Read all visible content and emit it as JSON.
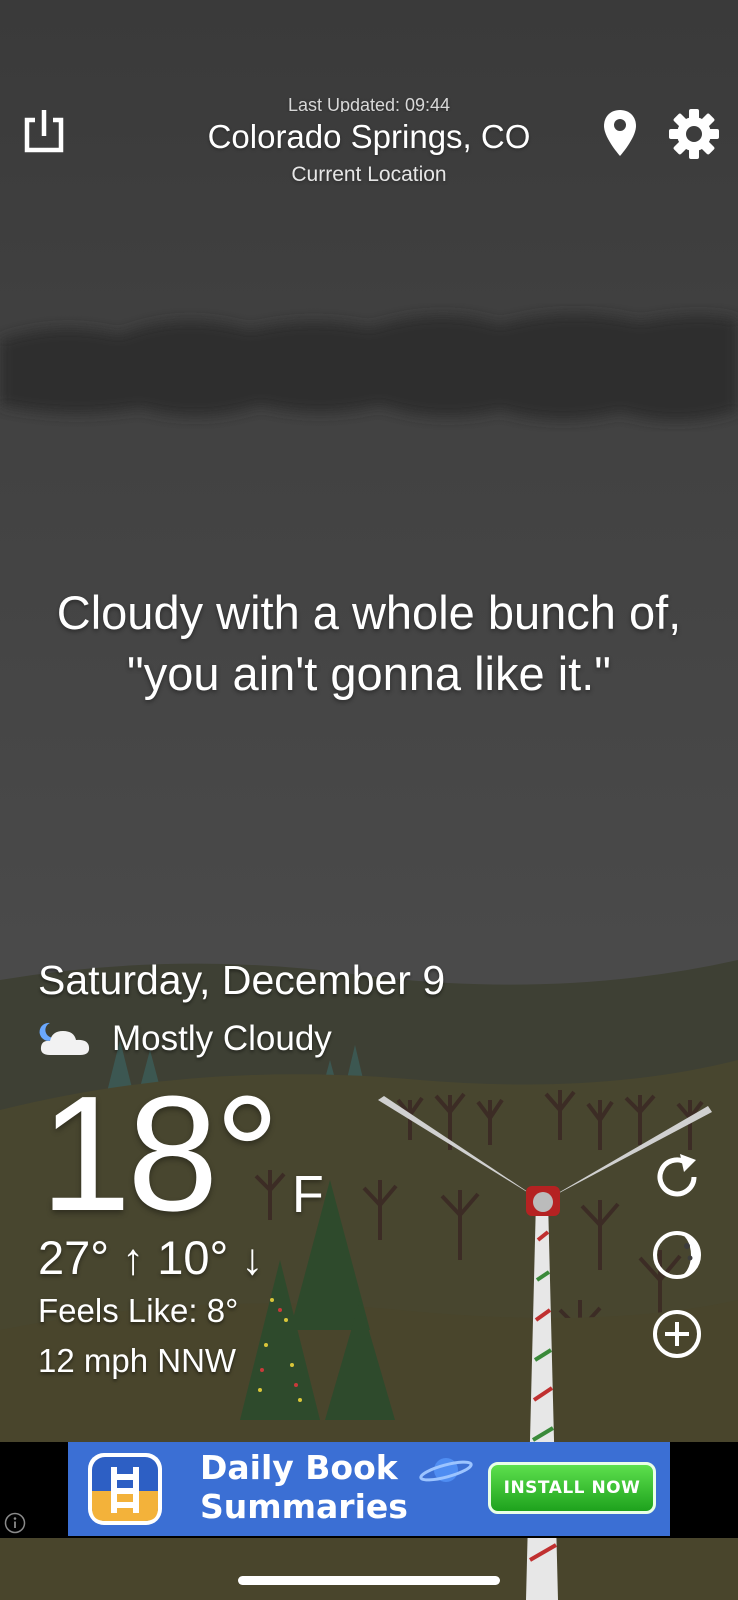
{
  "header": {
    "last_updated": "Last Updated: 09:44",
    "city": "Colorado Springs, CO",
    "location_label": "Current Location"
  },
  "quip": "Cloudy with a whole bunch of, \"you ain't gonna like it.\"",
  "weather": {
    "date": "Saturday, December 9",
    "condition": "Mostly Cloudy",
    "condition_icon": "partly-cloudy-night-icon",
    "temperature": "18°",
    "unit": "F",
    "high": "27°",
    "low": "10°",
    "feels_like": "Feels Like: 8°",
    "wind": "12 mph NNW"
  },
  "actions": {
    "share_icon": "share-icon",
    "location_icon": "map-pin-icon",
    "settings_icon": "gear-icon",
    "refresh_icon": "refresh-icon",
    "moon_icon": "moon-icon",
    "add_icon": "plus-circle-icon"
  },
  "ad": {
    "title_line1": "Daily Book",
    "title_line2": "Summaries",
    "cta": "INSTALL NOW",
    "info_icon": "info-icon"
  },
  "colors": {
    "sky": "#3c3c3c",
    "hills": "#4a4a32",
    "ad_blue": "#3b6fd4",
    "install_green": "#2fbf2c"
  }
}
